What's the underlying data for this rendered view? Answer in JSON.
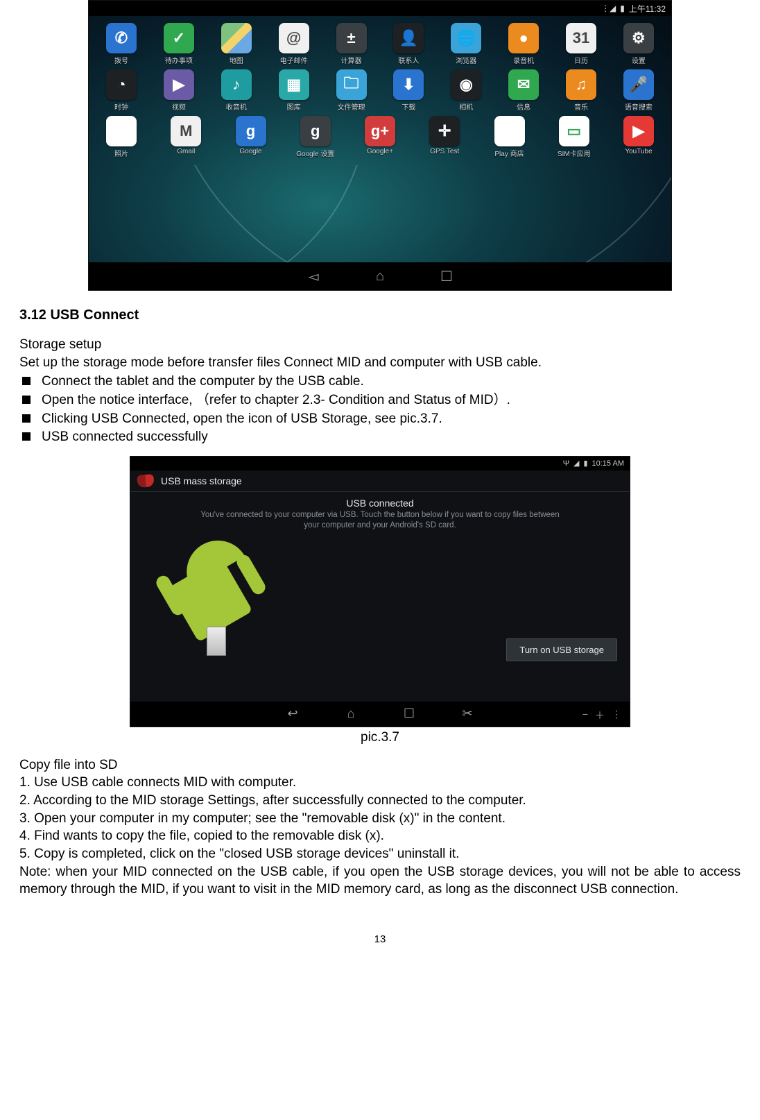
{
  "shot1": {
    "status_time": "上午11:32",
    "row1": [
      {
        "name": "phone",
        "label": "拨号",
        "glyph": "✆",
        "css": "bg-blue"
      },
      {
        "name": "todo",
        "label": "待办事项",
        "glyph": "✓",
        "css": "bg-green"
      },
      {
        "name": "maps",
        "label": "地图",
        "glyph": "",
        "css": "bg-map"
      },
      {
        "name": "email",
        "label": "电子邮件",
        "glyph": "@",
        "css": "bg-white"
      },
      {
        "name": "calculator",
        "label": "计算器",
        "glyph": "±",
        "css": "bg-grey"
      },
      {
        "name": "contacts",
        "label": "联系人",
        "glyph": "👤",
        "css": "bg-dark"
      },
      {
        "name": "browser",
        "label": "浏览器",
        "glyph": "🌐",
        "css": "bg-sky"
      },
      {
        "name": "audio-rec",
        "label": "录音机",
        "glyph": "●",
        "css": "bg-orange"
      },
      {
        "name": "calendar",
        "label": "日历",
        "glyph": "31",
        "css": "bg-white"
      },
      {
        "name": "settings",
        "label": "设置",
        "glyph": "⚙",
        "css": "bg-grey"
      }
    ],
    "row2": [
      {
        "name": "clock",
        "label": "时钟",
        "glyph": "◔",
        "css": "bg-dark"
      },
      {
        "name": "video",
        "label": "视频",
        "glyph": "▶",
        "css": "bg-purple"
      },
      {
        "name": "fm",
        "label": "收音机",
        "glyph": "♪",
        "css": "bg-teal"
      },
      {
        "name": "gallery",
        "label": "图库",
        "glyph": "▦",
        "css": "bg-aqua"
      },
      {
        "name": "files",
        "label": "文件管理",
        "glyph": "🗀",
        "css": "bg-sky"
      },
      {
        "name": "downloads",
        "label": "下载",
        "glyph": "⬇",
        "css": "bg-blue"
      },
      {
        "name": "camera",
        "label": "相机",
        "glyph": "◉",
        "css": "bg-dark"
      },
      {
        "name": "messages",
        "label": "信息",
        "glyph": "✉",
        "css": "bg-green"
      },
      {
        "name": "music",
        "label": "音乐",
        "glyph": "♫",
        "css": "bg-orange"
      },
      {
        "name": "voice",
        "label": "语音搜索",
        "glyph": "🎤",
        "css": "bg-blue"
      }
    ],
    "row3": [
      {
        "name": "photos",
        "label": "照片",
        "glyph": "✿",
        "css": "bg-pin"
      },
      {
        "name": "gmail",
        "label": "Gmail",
        "glyph": "M",
        "css": "bg-white"
      },
      {
        "name": "google",
        "label": "Google",
        "glyph": "g",
        "css": "bg-blue"
      },
      {
        "name": "google-settings",
        "label": "Google 设置",
        "glyph": "g",
        "css": "bg-grey"
      },
      {
        "name": "google-plus",
        "label": "Google+",
        "glyph": "g+",
        "css": "bg-red"
      },
      {
        "name": "gps-test",
        "label": "GPS Test",
        "glyph": "✛",
        "css": "bg-dark"
      },
      {
        "name": "play-store",
        "label": "Play 商店",
        "glyph": "▶",
        "css": "bg-play"
      },
      {
        "name": "sim-apps",
        "label": "SIM卡应用",
        "glyph": "▭",
        "css": "bg-sim"
      },
      {
        "name": "youtube",
        "label": "YouTube",
        "glyph": "▶",
        "css": "bg-yt"
      }
    ]
  },
  "body": {
    "heading": "3.12 USB Connect",
    "sub1": "Storage setup",
    "sub1_line": "Set up the storage mode before transfer files Connect MID and computer with USB cable.",
    "bullets": [
      "Connect the tablet and the computer by the USB cable.",
      "Open the notice interface,  （refer to chapter 2.3- Condition and Status of MID）.",
      "Clicking USB Connected, open the icon of USB Storage, see pic.3.7.",
      "USB connected successfully"
    ],
    "caption": "pic.3.7",
    "sub2": "Copy file into SD",
    "steps": [
      "1. Use USB cable connects MID with computer.",
      "2. According to the MID storage Settings, after successfully connected to the computer.",
      "3. Open your computer in my computer; see the \"removable disk (x)\" in the content.",
      "4. Find wants to copy the file, copied to the removable disk (x).",
      "5. Copy is completed, click on the \"closed USB storage devices\" uninstall it."
    ],
    "note": "Note: when your MID connected on the USB cable, if you open the USB storage devices, you will not be able to access memory through the MID, if you want to visit in the MID memory card, as long as the disconnect USB connection.",
    "page_number": "13"
  },
  "shot2": {
    "status_time": "10:15 AM",
    "title": "USB mass storage",
    "head": "USB connected",
    "sub": "You've connected to your computer via USB. Touch the button below if you want to copy files between your computer and your Android's SD card.",
    "button": "Turn on USB storage"
  }
}
